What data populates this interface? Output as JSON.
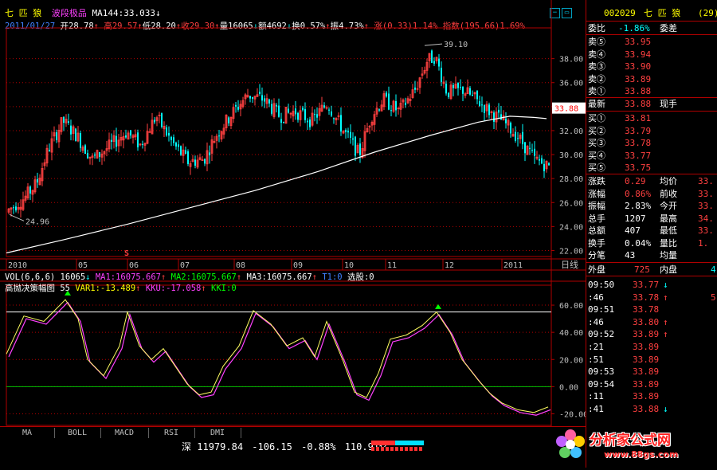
{
  "header": {
    "stock_name": "七 匹 狼",
    "indicator_label": "波段极品",
    "ma_label": "MA144:",
    "ma_value": "33.033",
    "ma_arrow": "↓",
    "date": "2011/01/27",
    "open_label": "开",
    "open": "28.78",
    "high_label": "高",
    "high": "29.57",
    "low_label": "低",
    "low": "28.20",
    "close_label": "收",
    "close": "29.30",
    "vol_label": "量",
    "vol": "16065",
    "amt_label": "额",
    "amt": "4692",
    "turn_label": "换",
    "turn": "0.57%",
    "amp_label": "振",
    "amp": "4.73%",
    "chg_label": "涨",
    "chg": "(0.33)1.14%",
    "index_label": "指数",
    "index": "(195.66)1.69%"
  },
  "main_chart": {
    "y_ticks": [
      "38.00",
      "36.00",
      "34.00",
      "32.00",
      "30.00",
      "28.00",
      "26.00",
      "24.00",
      "22.00"
    ],
    "current_price_tag": "33.88",
    "high_annotation": "39.10",
    "low_annotation": "24.96",
    "x_labels": [
      "2010",
      "05",
      "06",
      "07",
      "08",
      "09",
      "10",
      "11",
      "12",
      "2011"
    ],
    "x_axis_mode": "日线",
    "signal_mark": "S"
  },
  "vol_bar": {
    "label": "VOL(6,6,6)",
    "vol": "16065",
    "vol_arrow": "↓",
    "ma1": "MA1:16075.667",
    "ma1_arrow": "↑",
    "ma2": "MA2:16075.667",
    "ma2_arrow": "↑",
    "ma3": "MA3:16075.667",
    "ma3_arrow": "↑",
    "t1": "T1:0",
    "pick": "选股:0"
  },
  "sub_indicator": {
    "name": "高抛决策幅图",
    "param": "55",
    "var1": "VAR1:-13.489",
    "var1_arrow": "↑",
    "kku": "KKU:-17.058",
    "kku_arrow": "↑",
    "kki": "KKI:0",
    "y_ticks": [
      "60.00",
      "40.00",
      "20.00",
      "0.00",
      "-20.00"
    ]
  },
  "tabs": [
    "MA",
    "BOLL",
    "MACD",
    "RSI",
    "DMI"
  ],
  "status": {
    "market": "深",
    "index_value": "11979.84",
    "change": "-106.15",
    "pct": "-0.88%",
    "turnover": "110.91亿"
  },
  "quote_panel": {
    "code": "002029",
    "name": "七 匹 狼",
    "count": "(29)",
    "wei_bi_label": "委比",
    "wei_bi": "-1.86%",
    "wei_cha_label": "委差",
    "asks": [
      {
        "label": "卖⑤",
        "price": "33.95"
      },
      {
        "label": "卖④",
        "price": "33.94"
      },
      {
        "label": "卖③",
        "price": "33.90"
      },
      {
        "label": "卖②",
        "price": "33.89"
      },
      {
        "label": "卖①",
        "price": "33.88"
      }
    ],
    "last_label": "最新",
    "last": "33.88",
    "now_hand_label": "现手",
    "bids": [
      {
        "label": "买①",
        "price": "33.81"
      },
      {
        "label": "买②",
        "price": "33.79"
      },
      {
        "label": "买③",
        "price": "33.78"
      },
      {
        "label": "买④",
        "price": "33.77"
      },
      {
        "label": "买⑤",
        "price": "33.75"
      }
    ],
    "stats": [
      {
        "l1": "涨跌",
        "v1": "0.29",
        "l2": "均价",
        "v2": "33."
      },
      {
        "l1": "涨幅",
        "v1": "0.86%",
        "l2": "前收",
        "v2": "33."
      },
      {
        "l1": "振幅",
        "v1": "2.83%",
        "l2": "今开",
        "v2": "33."
      },
      {
        "l1": "总手",
        "v1": "1207",
        "l2": "最高",
        "v2": "34."
      },
      {
        "l1": "总额",
        "v1": "407",
        "l2": "最低",
        "v2": "33."
      },
      {
        "l1": "换手",
        "v1": "0.04%",
        "l2": "量比",
        "v2": "1."
      },
      {
        "l1": "分笔",
        "v1": "43",
        "l2": "均量",
        "v2": ""
      }
    ],
    "outer_label": "外盘",
    "outer": "725",
    "inner_label": "内盘",
    "inner": "4",
    "ticks": [
      {
        "time": "09:50",
        "price": "33.77",
        "arrow": "↓",
        "vol": ""
      },
      {
        "time": ":46",
        "price": "33.78",
        "arrow": "↑",
        "vol": "5"
      },
      {
        "time": "09:51",
        "price": "33.78",
        "arrow": "",
        "vol": ""
      },
      {
        "time": ":46",
        "price": "33.80",
        "arrow": "↑",
        "vol": ""
      },
      {
        "time": "09:52",
        "price": "33.89",
        "arrow": "↑",
        "vol": ""
      },
      {
        "time": ":21",
        "price": "33.89",
        "arrow": "",
        "vol": ""
      },
      {
        "time": ":51",
        "price": "33.89",
        "arrow": "",
        "vol": ""
      },
      {
        "time": "09:53",
        "price": "33.89",
        "arrow": "",
        "vol": ""
      },
      {
        "time": "09:54",
        "price": "33.89",
        "arrow": "",
        "vol": ""
      },
      {
        "time": ":11",
        "price": "33.89",
        "arrow": "",
        "vol": ""
      },
      {
        "time": ":41",
        "price": "33.88",
        "arrow": "↓",
        "vol": ""
      }
    ]
  },
  "watermark": {
    "text": "分析家公式网",
    "url": "www.88gs.com"
  },
  "colors": {
    "up": "#ff4040",
    "down": "#00ffff",
    "ma144": "#ffffff",
    "grid": "#b00000",
    "osc_yellow": "#ffff60",
    "osc_magenta": "#ff40ff",
    "level_line": "#ffffff",
    "zero_line": "#00c000"
  }
}
